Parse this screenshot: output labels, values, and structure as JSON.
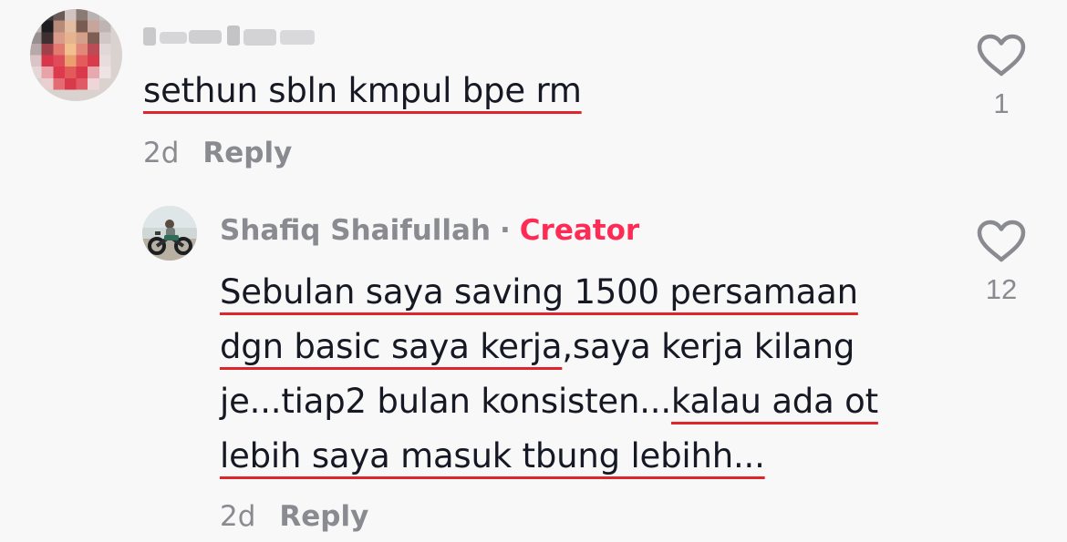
{
  "comment": {
    "username_blurred": "",
    "text": "sethun sbln kmpul bpe rm",
    "age": "2d",
    "reply_label": "Reply",
    "like_count": "1"
  },
  "reply": {
    "author": "Shafiq Shaifullah",
    "separator": "·",
    "badge": "Creator",
    "text_lines": [
      [
        "Sebulan saya saving 1500 persamaan"
      ],
      [
        "dgn basic saya kerja",
        ",saya kerja kilang"
      ],
      [
        "je...tiap2 bulan konsisten...",
        "kalau ada ot"
      ],
      [
        "lebih saya masuk tbung lebihh..."
      ]
    ],
    "age": "2d",
    "reply_label": "Reply",
    "like_count": "12"
  },
  "colors": {
    "background": "#f8f8f8",
    "text": "#161823",
    "muted": "#8a8b91",
    "creator_badge": "#fe2c55",
    "annotation_underline": "#e0242c"
  },
  "icons": {
    "like": "heart-outline-icon"
  }
}
